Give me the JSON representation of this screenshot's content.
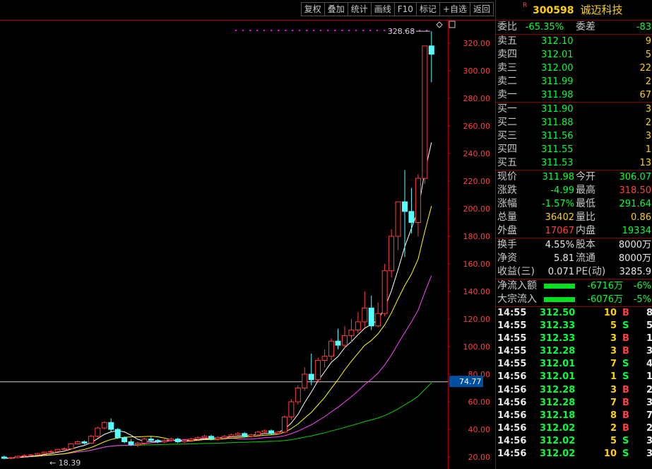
{
  "toolbar": [
    "复权",
    "叠加",
    "统计",
    "画线",
    "F10",
    "标记",
    "+自选",
    "返回"
  ],
  "stock": {
    "r_mark": "R",
    "code": "300598",
    "name": "诚迈科技"
  },
  "commission": {
    "ratio_label": "委比",
    "ratio": "-65.35%",
    "diff_label": "委差",
    "diff": "-83"
  },
  "asks": [
    {
      "label": "卖五",
      "price": "312.10",
      "vol": "9"
    },
    {
      "label": "卖四",
      "price": "312.01",
      "vol": "5"
    },
    {
      "label": "卖三",
      "price": "312.00",
      "vol": "22"
    },
    {
      "label": "卖二",
      "price": "311.99",
      "vol": "2"
    },
    {
      "label": "卖一",
      "price": "311.98",
      "vol": "67"
    }
  ],
  "bids": [
    {
      "label": "买一",
      "price": "311.90",
      "vol": "3"
    },
    {
      "label": "买二",
      "price": "311.88",
      "vol": "2"
    },
    {
      "label": "买三",
      "price": "311.56",
      "vol": "3"
    },
    {
      "label": "买四",
      "price": "311.55",
      "vol": "1"
    },
    {
      "label": "买五",
      "price": "311.53",
      "vol": "13"
    }
  ],
  "quote": [
    {
      "l1": "现价",
      "v1": "311.98",
      "c1": "green",
      "l2": "今开",
      "v2": "306.07",
      "c2": "green"
    },
    {
      "l1": "涨跌",
      "v1": "-4.99",
      "c1": "green",
      "l2": "最高",
      "v2": "318.50",
      "c2": "red"
    },
    {
      "l1": "涨幅",
      "v1": "-1.57%",
      "c1": "green",
      "l2": "最低",
      "v2": "291.64",
      "c2": "green"
    },
    {
      "l1": "总量",
      "v1": "36402",
      "c1": "yellow",
      "l2": "量比",
      "v2": "0.86",
      "c2": "yellow"
    },
    {
      "l1": "外盘",
      "v1": "17067",
      "c1": "red",
      "l2": "内盘",
      "v2": "19334",
      "c2": "green"
    }
  ],
  "fundamentals": [
    {
      "l1": "换手",
      "v1": "4.55%",
      "l2": "股本",
      "v2": "8000万"
    },
    {
      "l1": "净资",
      "v1": "5.81",
      "l2": "流通",
      "v2": "8000万"
    },
    {
      "l1": "收益(三)",
      "v1": "0.071",
      "l2": "PE(动)",
      "v2": "3285.9"
    }
  ],
  "flows": [
    {
      "label": "净流入额",
      "amount": "-6716万",
      "pct": "-6%"
    },
    {
      "label": "大宗流入",
      "amount": "-6076万",
      "pct": "-5%"
    }
  ],
  "ticks": [
    {
      "time": "14:55",
      "price": "312.50",
      "vol": "10",
      "side": "B",
      "n": "8"
    },
    {
      "time": "14:55",
      "price": "312.33",
      "vol": "5",
      "side": "S",
      "n": "5"
    },
    {
      "time": "14:55",
      "price": "312.33",
      "vol": "3",
      "side": "B",
      "n": "1"
    },
    {
      "time": "14:55",
      "price": "312.28",
      "vol": "3",
      "side": "B",
      "n": "3"
    },
    {
      "time": "14:55",
      "price": "312.01",
      "vol": "7",
      "side": "S",
      "n": "4"
    },
    {
      "time": "14:56",
      "price": "312.01",
      "vol": "1",
      "side": "S",
      "n": "1"
    },
    {
      "time": "14:56",
      "price": "312.28",
      "vol": "3",
      "side": "B",
      "n": "2"
    },
    {
      "time": "14:56",
      "price": "312.28",
      "vol": "7",
      "side": "B",
      "n": "3"
    },
    {
      "time": "14:56",
      "price": "312.18",
      "vol": "8",
      "side": "B",
      "n": "7"
    },
    {
      "time": "14:56",
      "price": "312.02",
      "vol": "2",
      "side": "B",
      "n": "2"
    },
    {
      "time": "14:56",
      "price": "312.02",
      "vol": "5",
      "side": "S",
      "n": "3"
    },
    {
      "time": "14:56",
      "price": "312.02",
      "vol": "10",
      "side": "S",
      "n": "3"
    }
  ],
  "chart_data": {
    "type": "candlestick",
    "y_ticks": [
      20,
      40,
      60,
      80,
      100,
      120,
      140,
      160,
      180,
      200,
      220,
      240,
      260,
      280,
      300,
      320
    ],
    "crosshair_value": "74.77",
    "high_marker": "328.68",
    "low_marker": "18.39",
    "colors": {
      "up": "#ff3c3c",
      "down": "#54ffff",
      "ma5": "#ffffff",
      "ma10": "#ffff00",
      "ma20": "#ff40ff",
      "ma60": "#00d000"
    },
    "candles": [
      [
        20,
        21,
        18.39,
        19
      ],
      [
        19,
        20,
        18.5,
        19.5
      ],
      [
        19.5,
        21,
        19,
        20.5
      ],
      [
        20.5,
        22,
        20,
        21
      ],
      [
        21,
        22,
        20.5,
        21.5
      ],
      [
        21.5,
        23,
        21,
        22.5
      ],
      [
        22.5,
        24,
        22,
        23.5
      ],
      [
        23.5,
        25,
        23,
        24
      ],
      [
        24,
        26,
        23.5,
        25.5
      ],
      [
        25.5,
        27,
        25,
        26
      ],
      [
        26,
        30,
        25.5,
        29.5
      ],
      [
        29.5,
        32,
        29,
        31
      ],
      [
        31,
        32,
        29,
        30
      ],
      [
        30,
        36,
        29.5,
        35
      ],
      [
        35,
        42,
        34,
        41
      ],
      [
        41,
        46,
        40,
        45
      ],
      [
        45,
        48,
        38,
        40
      ],
      [
        40,
        41,
        33,
        34
      ],
      [
        34,
        35,
        30,
        31
      ],
      [
        31,
        33,
        28,
        29
      ],
      [
        29,
        31,
        27,
        30
      ],
      [
        30,
        34,
        29,
        33
      ],
      [
        33,
        35,
        31,
        32
      ],
      [
        32,
        33,
        30,
        31
      ],
      [
        31,
        33,
        30,
        32
      ],
      [
        32,
        34,
        31,
        33
      ],
      [
        33,
        34,
        30,
        31
      ],
      [
        31,
        33,
        30,
        32
      ],
      [
        32,
        34,
        31,
        33
      ],
      [
        33,
        35,
        32,
        34
      ],
      [
        34,
        36,
        33,
        35
      ],
      [
        35,
        36,
        32,
        33
      ],
      [
        33,
        35,
        32,
        34
      ],
      [
        34,
        36,
        33,
        35
      ],
      [
        35,
        37,
        34,
        36
      ],
      [
        36,
        38,
        35,
        37
      ],
      [
        37,
        38,
        34,
        35
      ],
      [
        35,
        37,
        34,
        36
      ],
      [
        36,
        39,
        35,
        38
      ],
      [
        38,
        40,
        37,
        39
      ],
      [
        39,
        40,
        36,
        37
      ],
      [
        37,
        39,
        36,
        38
      ],
      [
        38,
        50,
        37,
        49
      ],
      [
        49,
        62,
        47,
        60
      ],
      [
        60,
        72,
        58,
        70
      ],
      [
        70,
        85,
        68,
        80
      ],
      [
        80,
        95,
        72,
        76
      ],
      [
        76,
        92,
        74,
        90
      ],
      [
        90,
        98,
        85,
        93
      ],
      [
        93,
        106,
        90,
        104
      ],
      [
        104,
        113,
        98,
        101
      ],
      [
        101,
        115,
        99,
        108
      ],
      [
        108,
        120,
        103,
        112
      ],
      [
        112,
        125,
        110,
        118
      ],
      [
        118,
        140,
        114,
        128
      ],
      [
        128,
        137,
        112,
        115
      ],
      [
        115,
        132,
        114,
        124
      ],
      [
        124,
        160,
        122,
        155
      ],
      [
        155,
        185,
        150,
        180
      ],
      [
        180,
        200,
        170,
        205
      ],
      [
        205,
        228,
        165,
        198
      ],
      [
        198,
        215,
        182,
        190
      ],
      [
        190,
        225,
        180,
        222
      ],
      [
        222,
        310,
        218,
        318
      ],
      [
        318,
        328.68,
        291.64,
        311.98
      ]
    ]
  }
}
